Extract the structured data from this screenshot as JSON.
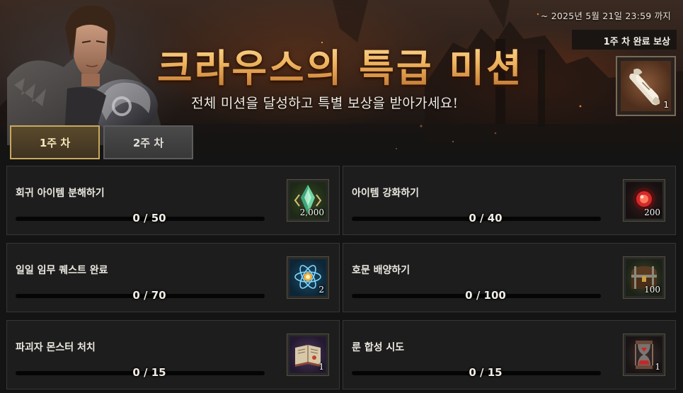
{
  "event": {
    "deadline": "~ 2025년 5월 21일 23:59 까지",
    "title": "크라우스의 특급 미션",
    "subtitle": "전체 미션을 달성하고 특별 보상을 받아가세요!",
    "completion_reward": {
      "label": "1주 차 완료 보상",
      "icon": "scroll-icon",
      "quantity": "1"
    }
  },
  "tabs": [
    {
      "label": "1주 차",
      "active": true
    },
    {
      "label": "2주 차",
      "active": false
    }
  ],
  "missions": [
    {
      "name": "회귀 아이템 분해하기",
      "progress": "0 / 50",
      "progress_fraction": 0,
      "reward_icon": "green-crystal-icon",
      "reward_qty": "2,000"
    },
    {
      "name": "아이템 강화하기",
      "progress": "0 / 40",
      "progress_fraction": 0,
      "reward_icon": "red-orb-icon",
      "reward_qty": "200"
    },
    {
      "name": "일일 임무 퀘스트 완료",
      "progress": "0 / 70",
      "progress_fraction": 0,
      "reward_icon": "blue-atom-orb-icon",
      "reward_qty": "2"
    },
    {
      "name": "호문 배양하기",
      "progress": "0 / 100",
      "progress_fraction": 0,
      "reward_icon": "treasure-chest-icon",
      "reward_qty": "100"
    },
    {
      "name": "파괴자 몬스터 처치",
      "progress": "0 / 15",
      "progress_fraction": 0,
      "reward_icon": "spell-book-icon",
      "reward_qty": "1"
    },
    {
      "name": "룬 합성 시도",
      "progress": "0 / 15",
      "progress_fraction": 0,
      "reward_icon": "hourglass-icon",
      "reward_qty": "1"
    }
  ],
  "colors": {
    "title_gold": "#f0b660",
    "tab_active_border": "#c7a95e",
    "card_bg": "#1d1d1d"
  }
}
